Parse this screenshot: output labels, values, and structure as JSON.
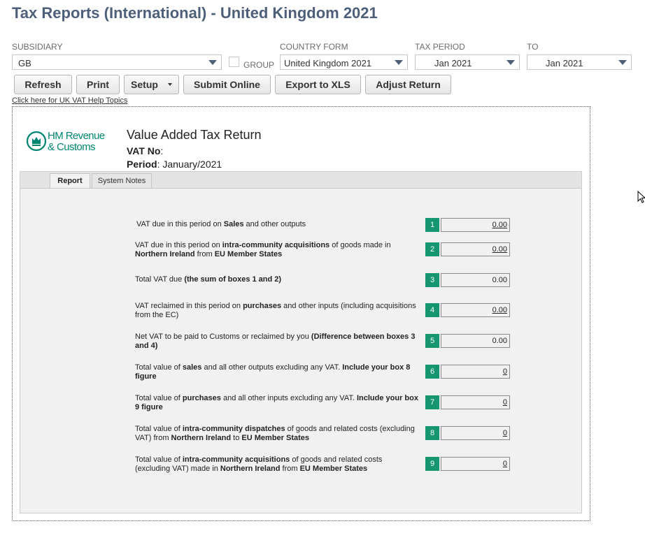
{
  "header": {
    "title": "Tax Reports (International) - United Kingdom 2021"
  },
  "filters": {
    "subsidiary_label": "SUBSIDIARY",
    "subsidiary_value": "GB",
    "group_label": "GROUP",
    "country_form_label": "COUNTRY FORM",
    "country_form_value": "United Kingdom 2021",
    "tax_period_label": "TAX PERIOD",
    "tax_period_value": "Jan 2021",
    "to_label": "TO",
    "to_value": "Jan 2021"
  },
  "toolbar": {
    "refresh": "Refresh",
    "print": "Print",
    "setup": "Setup",
    "submit_online": "Submit Online",
    "export_xls": "Export to XLS",
    "adjust_return": "Adjust Return"
  },
  "help_link": "Click here for UK VAT Help Topics",
  "report": {
    "logo_line1": "HM Revenue",
    "logo_line2": "& Customs",
    "title": "Value Added Tax Return",
    "vat_no_label": "VAT No",
    "vat_no_sep": ":",
    "period_label": "Period",
    "period_value": ": January/2021",
    "tabs": [
      "Report",
      "System Notes"
    ],
    "boxes": [
      {
        "num": "1",
        "value": "0.00",
        "desc": [
          {
            "t": "VAT due in this period on "
          },
          {
            "t": "Sales",
            "b": true
          },
          {
            "t": " and other outputs"
          }
        ]
      },
      {
        "num": "2",
        "value": "0.00",
        "desc": [
          {
            "t": "VAT due in this period on "
          },
          {
            "t": "intra-community acquisitions",
            "b": true
          },
          {
            "t": " of goods made in "
          },
          {
            "t": "Northern Ireland",
            "b": true
          },
          {
            "t": " from "
          },
          {
            "t": "EU Member States",
            "b": true
          }
        ]
      },
      {
        "num": "3",
        "value": "0.00",
        "desc": [
          {
            "t": "Total VAT due "
          },
          {
            "t": "(the sum of boxes 1 and 2)",
            "b": true
          }
        ]
      },
      {
        "num": "4",
        "value": "0.00",
        "desc": [
          {
            "t": "VAT reclaimed in this period on "
          },
          {
            "t": "purchases",
            "b": true
          },
          {
            "t": " and other inputs (including acquisitions from the EC)"
          }
        ]
      },
      {
        "num": "5",
        "value": "0.00",
        "desc": [
          {
            "t": "Net VAT to be paid to Customs or reclaimed by you "
          },
          {
            "t": "(Difference between boxes 3 and 4)",
            "b": true
          }
        ]
      },
      {
        "num": "6",
        "value": "0",
        "desc": [
          {
            "t": "Total value of "
          },
          {
            "t": "sales",
            "b": true
          },
          {
            "t": " and all other outputs excluding any VAT. "
          },
          {
            "t": "Include your box 8 figure",
            "b": true
          }
        ]
      },
      {
        "num": "7",
        "value": "0",
        "desc": [
          {
            "t": "Total value of "
          },
          {
            "t": "purchases",
            "b": true
          },
          {
            "t": " and all other inputs excluding any VAT. "
          },
          {
            "t": "Include your box 9 figure",
            "b": true
          }
        ]
      },
      {
        "num": "8",
        "value": "0",
        "desc": [
          {
            "t": "Total value of "
          },
          {
            "t": "intra-community dispatches",
            "b": true
          },
          {
            "t": " of goods and related costs (excluding VAT) from "
          },
          {
            "t": "Northern Ireland",
            "b": true
          },
          {
            "t": " to "
          },
          {
            "t": "EU Member States",
            "b": true
          }
        ]
      },
      {
        "num": "9",
        "value": "0",
        "desc": [
          {
            "t": "Total value of "
          },
          {
            "t": "intra-community acquisitions",
            "b": true
          },
          {
            "t": " of goods and related costs (excluding VAT) made in "
          },
          {
            "t": "Northern Ireland",
            "b": true
          },
          {
            "t": " from "
          },
          {
            "t": "EU Member States",
            "b": true
          }
        ]
      }
    ]
  },
  "colors": {
    "title": "#4d5f79",
    "box_badge": "#159570",
    "logo": "#008670"
  }
}
